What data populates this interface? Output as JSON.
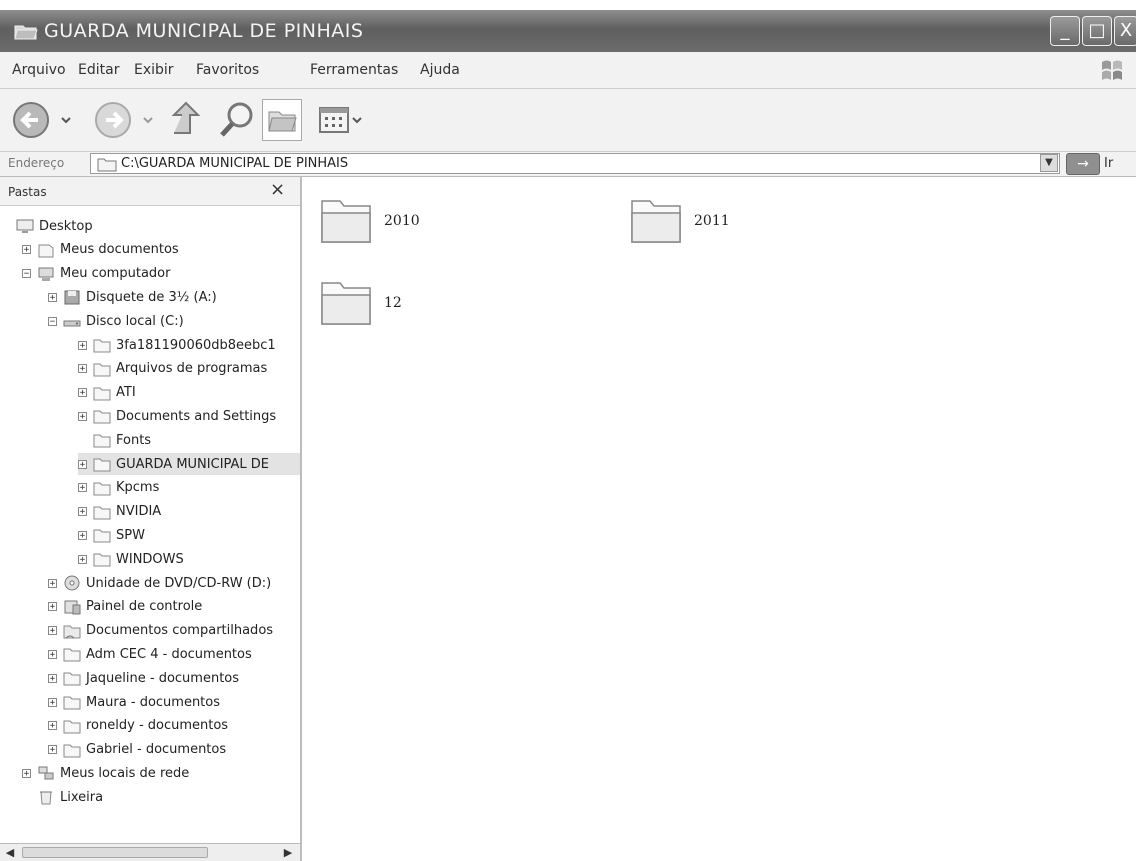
{
  "window": {
    "title": "GUARDA MUNICIPAL DE PINHAIS",
    "buttons": {
      "minimize": "_",
      "maximize": "□",
      "close": "X"
    }
  },
  "menubar": [
    "Arquivo",
    "Editar",
    "Exibir",
    "Favoritos",
    "Ferramentas",
    "Ajuda"
  ],
  "toolbar": {
    "icons": [
      "back-icon",
      "forward-icon",
      "up-icon",
      "search-icon",
      "folders-icon",
      "views-icon"
    ]
  },
  "address": {
    "label": "Endereço",
    "value": "C:\\GUARDA MUNICIPAL DE PINHAIS",
    "go_label": "Ir"
  },
  "folders_pane": {
    "title": "Pastas",
    "close": "×",
    "tree": [
      {
        "label": "Desktop",
        "level": 0,
        "expander": "",
        "icon": "desktop-icon"
      },
      {
        "label": "Meus documentos",
        "level": 1,
        "expander": "+",
        "icon": "documents-icon"
      },
      {
        "label": "Meu computador",
        "level": 1,
        "expander": "-",
        "icon": "computer-icon"
      },
      {
        "label": "Disquete de 3½ (A:)",
        "level": 2,
        "expander": "+",
        "icon": "floppy-icon"
      },
      {
        "label": "Disco local (C:)",
        "level": 2,
        "expander": "-",
        "icon": "harddisk-icon"
      },
      {
        "label": "3fa181190060db8eebc1",
        "level": 3,
        "expander": "+",
        "icon": "folder-icon"
      },
      {
        "label": "Arquivos de programas",
        "level": 3,
        "expander": "+",
        "icon": "folder-icon"
      },
      {
        "label": "ATI",
        "level": 3,
        "expander": "+",
        "icon": "folder-icon"
      },
      {
        "label": "Documents and Settings",
        "level": 3,
        "expander": "+",
        "icon": "folder-icon"
      },
      {
        "label": "Fonts",
        "level": 3,
        "expander": "",
        "icon": "folder-icon"
      },
      {
        "label": "GUARDA MUNICIPAL DE",
        "level": 3,
        "expander": "+",
        "icon": "folder-icon",
        "selected": true
      },
      {
        "label": "Kpcms",
        "level": 3,
        "expander": "+",
        "icon": "folder-icon"
      },
      {
        "label": "NVIDIA",
        "level": 3,
        "expander": "+",
        "icon": "folder-icon"
      },
      {
        "label": "SPW",
        "level": 3,
        "expander": "+",
        "icon": "folder-icon"
      },
      {
        "label": "WINDOWS",
        "level": 3,
        "expander": "+",
        "icon": "folder-icon"
      },
      {
        "label": "Unidade de DVD/CD-RW (D:)",
        "level": 2,
        "expander": "+",
        "icon": "cdrom-icon"
      },
      {
        "label": "Painel de controle",
        "level": 2,
        "expander": "+",
        "icon": "control-panel-icon"
      },
      {
        "label": "Documentos compartilhados",
        "level": 2,
        "expander": "+",
        "icon": "shared-folder-icon"
      },
      {
        "label": "Adm CEC 4 - documentos",
        "level": 2,
        "expander": "+",
        "icon": "folder-icon"
      },
      {
        "label": "Jaqueline - documentos",
        "level": 2,
        "expander": "+",
        "icon": "folder-icon"
      },
      {
        "label": "Maura - documentos",
        "level": 2,
        "expander": "+",
        "icon": "folder-icon"
      },
      {
        "label": "roneldy - documentos",
        "level": 2,
        "expander": "+",
        "icon": "folder-icon"
      },
      {
        "label": "Gabriel - documentos",
        "level": 2,
        "expander": "+",
        "icon": "folder-icon"
      },
      {
        "label": "Meus locais de rede",
        "level": 1,
        "expander": "+",
        "icon": "network-icon"
      },
      {
        "label": "Lixeira",
        "level": 1,
        "expander": "",
        "icon": "recycle-bin-icon"
      }
    ]
  },
  "content": {
    "folders": [
      "2010",
      "2011",
      "12"
    ]
  }
}
